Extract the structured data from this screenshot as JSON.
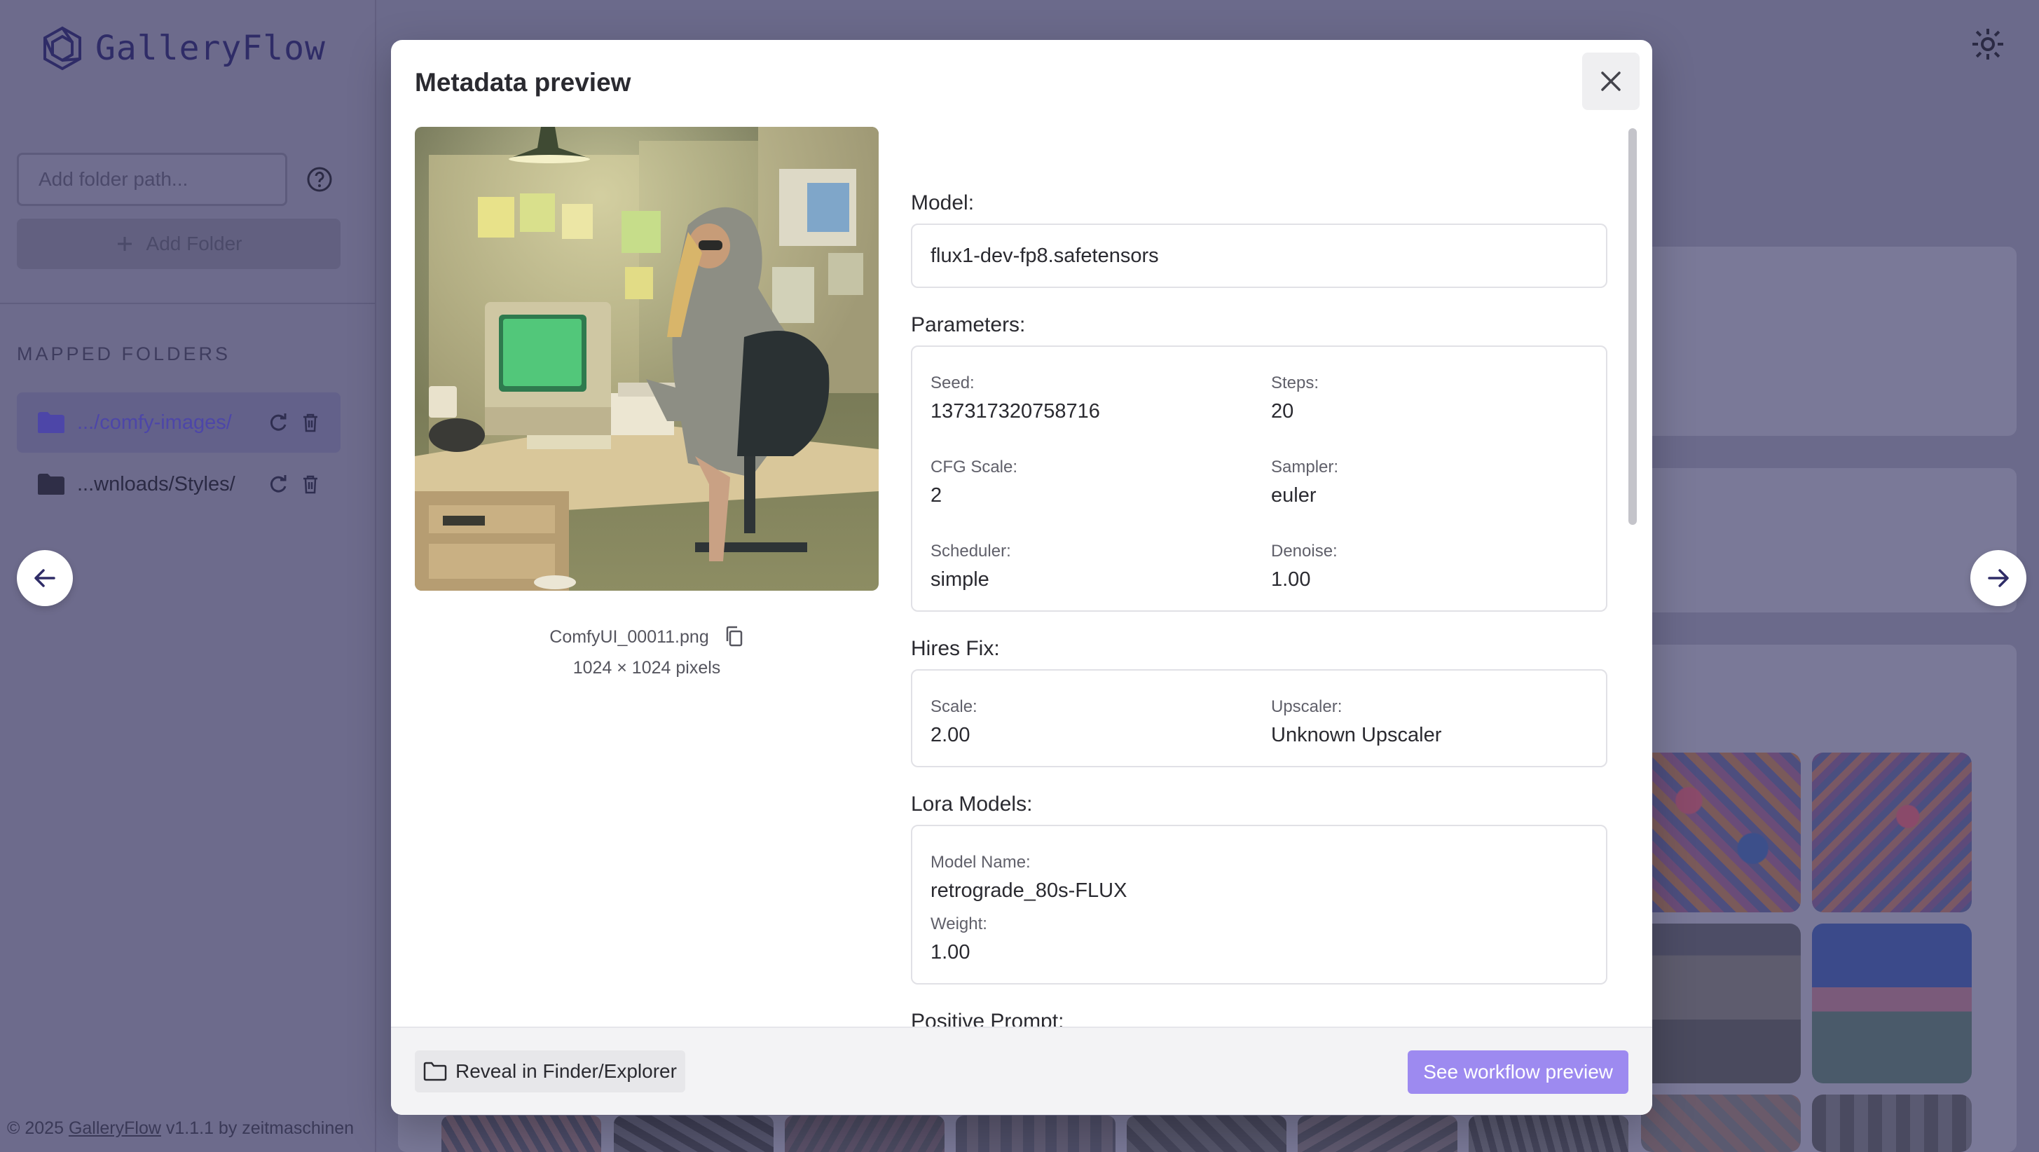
{
  "app": {
    "name": "GalleryFlow",
    "footer_prefix": "© 2025 ",
    "footer_link": "GalleryFlow",
    "footer_suffix": " v1.1.1 by zeitmaschinen"
  },
  "sidebar": {
    "folder_input_placeholder": "Add folder path...",
    "add_folder_label": "Add Folder",
    "mapped_folders_title": "MAPPED FOLDERS",
    "folders": [
      {
        "label": ".../comfy-images/",
        "active": true
      },
      {
        "label": "...wnloads/Styles/",
        "active": false
      }
    ]
  },
  "modal": {
    "title": "Metadata preview",
    "file_name": "ComfyUI_00011.png",
    "dimensions": "1024 × 1024 pixels",
    "model_label": "Model:",
    "model_value": "flux1-dev-fp8.safetensors",
    "parameters_label": "Parameters:",
    "parameters": {
      "seed_label": "Seed:",
      "seed": "137317320758716",
      "steps_label": "Steps:",
      "steps": "20",
      "cfg_label": "CFG Scale:",
      "cfg": "2",
      "sampler_label": "Sampler:",
      "sampler": "euler",
      "scheduler_label": "Scheduler:",
      "scheduler": "simple",
      "denoise_label": "Denoise:",
      "denoise": "1.00"
    },
    "hires_label": "Hires Fix:",
    "hires": {
      "scale_label": "Scale:",
      "scale": "2.00",
      "upscaler_label": "Upscaler:",
      "upscaler": "Unknown Upscaler"
    },
    "lora_label": "Lora Models:",
    "lora": {
      "name_label": "Model Name:",
      "name": "retrograde_80s-FLUX",
      "weight_label": "Weight:",
      "weight": "1.00"
    },
    "positive_prompt_label": "Positive Prompt:",
    "reveal_button": "Reveal in Finder/Explorer",
    "workflow_button": "See workflow preview"
  },
  "colors": {
    "accent": "#9d8af0",
    "overlay": "#6b6a8b",
    "logo": "#2f2c67"
  },
  "icons": [
    "logo-icon",
    "help-icon",
    "plus-icon",
    "folder-icon",
    "refresh-icon",
    "trash-icon",
    "arrow-left-icon",
    "arrow-right-icon",
    "close-icon",
    "copy-icon",
    "theme-icon"
  ]
}
